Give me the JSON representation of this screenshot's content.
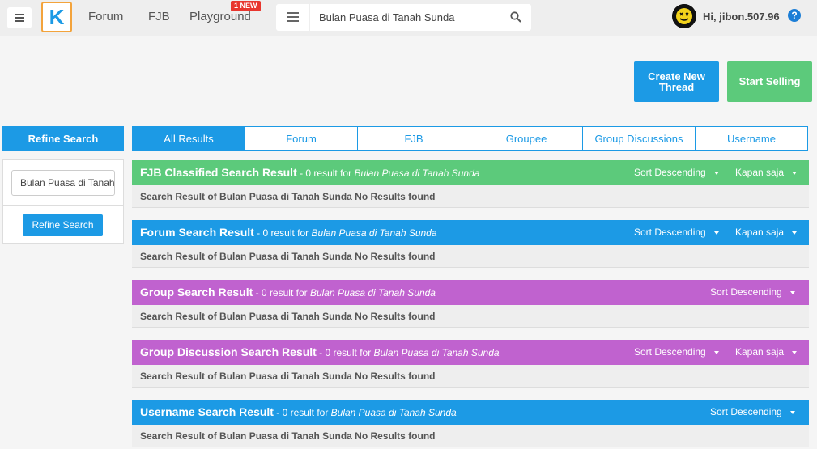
{
  "header": {
    "logo_letter": "K",
    "nav": [
      {
        "label": "Forum"
      },
      {
        "label": "FJB"
      },
      {
        "label": "Playground"
      }
    ],
    "new_badge": "1 NEW",
    "search_query": "Bulan Puasa di Tanah Sunda",
    "user_greeting": "Hi, jibon.507.96",
    "help_icon": "?"
  },
  "actions": {
    "create_thread": "Create New Thread",
    "start_selling": "Start Selling"
  },
  "refine": {
    "title": "Refine Search",
    "input_value": "Bulan Puasa di Tanah Sunda",
    "button": "Refine Search"
  },
  "tabs": [
    {
      "label": "All Results",
      "active": true
    },
    {
      "label": "Forum"
    },
    {
      "label": "FJB"
    },
    {
      "label": "Groupee"
    },
    {
      "label": "Group Discussions"
    },
    {
      "label": "Username"
    }
  ],
  "sections": [
    {
      "title": "FJB Classified Search Result",
      "sub_prefix": " - 0 result for ",
      "query": "Bulan Puasa di Tanah Sunda",
      "sort": "Sort Descending",
      "time": "Kapan saja",
      "body": "Search Result of Bulan Puasa di Tanah Sunda No Results found",
      "color": "#5cca7b"
    },
    {
      "title": "Forum Search Result",
      "sub_prefix": " - 0 result for ",
      "query": "Bulan Puasa di Tanah Sunda",
      "sort": "Sort Descending",
      "time": "Kapan saja",
      "body": "Search Result of Bulan Puasa di Tanah Sunda No Results found",
      "color": "#1c9ae5"
    },
    {
      "title": "Group Search Result",
      "sub_prefix": " - 0 result for ",
      "query": "Bulan Puasa di Tanah Sunda",
      "sort": "Sort Descending",
      "body": "Search Result of Bulan Puasa di Tanah Sunda No Results found",
      "color": "#c062cf"
    },
    {
      "title": "Group Discussion Search Result",
      "sub_prefix": " - 0 result for ",
      "query": "Bulan Puasa di Tanah Sunda",
      "sort": "Sort Descending",
      "time": "Kapan saja",
      "body": "Search Result of Bulan Puasa di Tanah Sunda No Results found",
      "color": "#c062cf"
    },
    {
      "title": "Username Search Result",
      "sub_prefix": " - 0 result for ",
      "query": "Bulan Puasa di Tanah Sunda",
      "sort": "Sort Descending",
      "body": "Search Result of Bulan Puasa di Tanah Sunda No Results found",
      "color": "#1c9ae5"
    }
  ]
}
